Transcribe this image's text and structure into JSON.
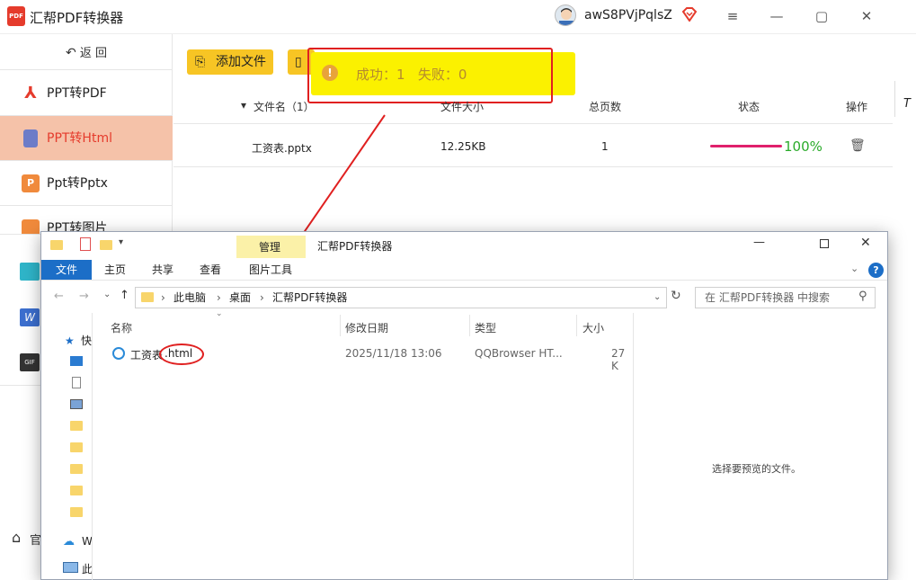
{
  "app": {
    "title": "汇帮PDF转换器",
    "username": "awS8PVjPqlsZ"
  },
  "window_controls": {
    "menu": "≡",
    "minimize": "—",
    "maximize": "▢",
    "close": "✕"
  },
  "sidebar": {
    "back_label": "返  回",
    "items": [
      {
        "label": "PPT转PDF",
        "icon": "pdf-icon"
      },
      {
        "label": "PPT转Html",
        "icon": "html-icon",
        "active": true
      },
      {
        "label": "Ppt转Pptx",
        "icon": "pptx-icon"
      },
      {
        "label": "PPT转图片",
        "icon": "image-icon"
      }
    ],
    "footer_label": "官"
  },
  "toolbar": {
    "add_file": "添加文件"
  },
  "toast": {
    "message": "成功：1   失败：0"
  },
  "table": {
    "headers": [
      "文件名（1）",
      "文件大小",
      "总页数",
      "状态",
      "操作"
    ],
    "rows": [
      {
        "name": "工资表.pptx",
        "size": "12.25KB",
        "pages": "1",
        "progress": 1.0,
        "status": "100%"
      }
    ]
  },
  "explorer": {
    "title": "汇帮PDF转换器",
    "manage_tab": "管理",
    "tabs": [
      "文件",
      "主页",
      "共享",
      "查看",
      "图片工具"
    ],
    "path": [
      "此电脑",
      "桌面",
      "汇帮PDF转换器"
    ],
    "search_placeholder": "在 汇帮PDF转换器 中搜索",
    "columns": [
      "名称",
      "修改日期",
      "类型",
      "大小"
    ],
    "files": [
      {
        "name_base": "工资表",
        "name_ext": ".html",
        "modified": "2025/11/18 13:06",
        "type": "QQBrowser HT...",
        "size": "27 K"
      }
    ],
    "preview_text": "选择要预览的文件。",
    "nav": {
      "quick": "快",
      "wps": "W",
      "thispc": "此"
    }
  },
  "colors": {
    "accent": "#e53b2c",
    "button": "#f7c524",
    "toast": "#fbf100",
    "progress": "#e0206c",
    "status_green": "#2bab2b"
  }
}
